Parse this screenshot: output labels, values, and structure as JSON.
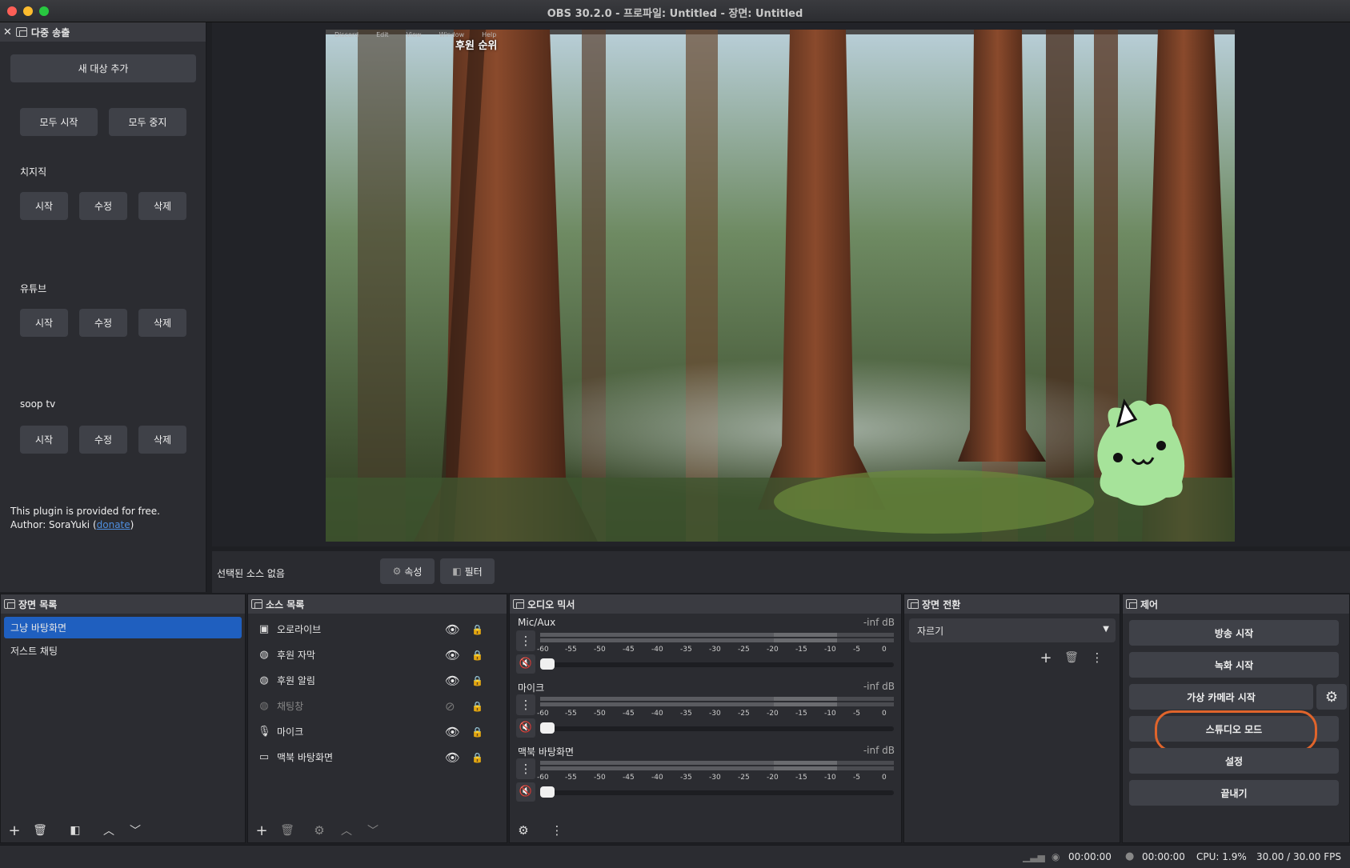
{
  "window": {
    "title": "OBS 30.2.0 - 프로파일: Untitled - 장면: Untitled"
  },
  "multistream": {
    "dock_title": "다중 송출",
    "add_target": "새 대상 추가",
    "start_all": "모두 시작",
    "stop_all": "모두 중지",
    "targets": [
      {
        "name": "치지직",
        "start": "시작",
        "edit": "수정",
        "delete": "삭제"
      },
      {
        "name": "유튜브",
        "start": "시작",
        "edit": "수정",
        "delete": "삭제"
      },
      {
        "name": "soop tv",
        "start": "시작",
        "edit": "수정",
        "delete": "삭제"
      }
    ],
    "footer_line1": "This plugin is provided for free.",
    "footer_author_prefix": "Author: SoraYuki (",
    "footer_link": "donate",
    "footer_suffix": ")"
  },
  "preview": {
    "overlay_text": "후원 순위",
    "menubar_items": [
      "Discord",
      "Edit",
      "View",
      "Window",
      "Help"
    ]
  },
  "context_bar": {
    "no_source": "선택된 소스 없음",
    "properties": "속성",
    "filters": "필터"
  },
  "scenes": {
    "title": "장면 목록",
    "items": [
      "그냥 바탕화면",
      "저스트 채팅"
    ],
    "selected": "그냥 바탕화면"
  },
  "sources": {
    "title": "소스 목록",
    "items": [
      {
        "name": "오로라이브",
        "icon": "image-icon",
        "visible": true
      },
      {
        "name": "후원 자막",
        "icon": "globe-icon",
        "visible": true
      },
      {
        "name": "후원 알림",
        "icon": "globe-icon",
        "visible": true
      },
      {
        "name": "채팅창",
        "icon": "globe-icon",
        "visible": false
      },
      {
        "name": "마이크",
        "icon": "microphone-icon",
        "visible": true
      },
      {
        "name": "맥북 바탕화면",
        "icon": "monitor-icon",
        "visible": true
      }
    ]
  },
  "mixer": {
    "title": "오디오 믹서",
    "scale": [
      "-60",
      "-55",
      "-50",
      "-45",
      "-40",
      "-35",
      "-30",
      "-25",
      "-20",
      "-15",
      "-10",
      "-5",
      "0"
    ],
    "channels": [
      {
        "name": "Mic/Aux",
        "level": "-inf dB"
      },
      {
        "name": "마이크",
        "level": "-inf dB"
      },
      {
        "name": "맥북 바탕화면",
        "level": "-inf dB"
      }
    ]
  },
  "transitions": {
    "title": "장면 전환",
    "selected": "자르기"
  },
  "controls": {
    "title": "제어",
    "start_streaming": "방송 시작",
    "start_recording": "녹화 시작",
    "start_virtualcam": "가상 카메라 시작",
    "studio_mode": "스튜디오 모드",
    "settings": "설정",
    "exit": "끝내기"
  },
  "status": {
    "stream_time": "00:00:00",
    "record_time": "00:00:00",
    "cpu": "CPU: 1.9%",
    "fps": "30.00 / 30.00 FPS"
  },
  "colors": {
    "selected_scene": "#1f5fbf",
    "highlight_ring": "#e0642b",
    "mute_red": "#c0392b"
  }
}
